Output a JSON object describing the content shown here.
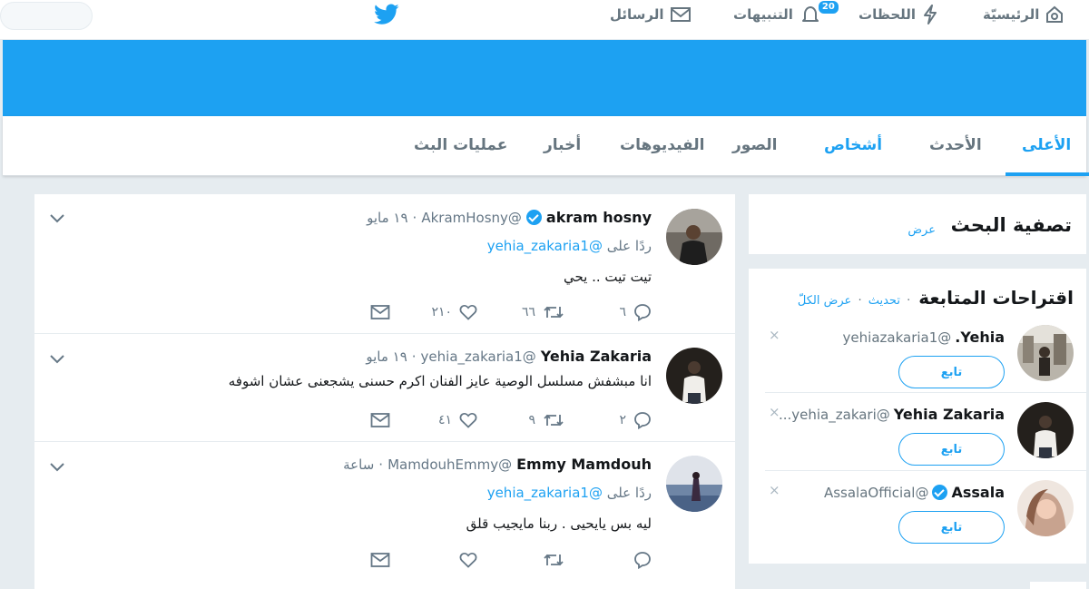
{
  "nav": {
    "home": "الرئيسيّة",
    "moments": "اللحظات",
    "notifications": "التنبيهات",
    "notifications_badge": "20",
    "messages": "الرسائل"
  },
  "tabs": {
    "top": "الأعلى",
    "latest": "الأحدث",
    "people": "أشخاص",
    "photos": "الصور",
    "videos": "الفيديوهات",
    "news": "أخبار",
    "broadcasts": "عمليات البث"
  },
  "filter": {
    "title": "تصفية البحث",
    "show": "عرض"
  },
  "wtf": {
    "title": "اقتراحات المتابعة",
    "refresh": "تحديث",
    "view_all": "عرض الكلّ",
    "sep": "·",
    "close": "×",
    "follow_label": "تابع",
    "items": [
      {
        "name": "Yehia.",
        "handle": "@yehiazakaria1"
      },
      {
        "name": "Yehia Zakaria",
        "handle": "@yehia_zakari..."
      },
      {
        "name": "Assala",
        "handle": "@AssalaOfficial"
      }
    ]
  },
  "tweets": [
    {
      "name": "akram hosny",
      "handle": "@AkramHosny",
      "time": "١٩ مايو",
      "reply_prefix": "ردًا على",
      "reply_to": "@yehia_zakaria1",
      "text": "تيت تيت .. يحي",
      "replies": "٦",
      "retweets": "٦٦",
      "likes": "٢١٠"
    },
    {
      "name": "Yehia Zakaria",
      "handle": "@yehia_zakaria1",
      "time": "١٩ مايو",
      "text": "انا مبشفش مسلسل الوصية عايز الفنان اكرم حسنى يشجعنى عشان اشوفه",
      "replies": "٢",
      "retweets": "٩",
      "likes": "٤١"
    },
    {
      "name": "Emmy Mamdouh",
      "handle": "@MamdouhEmmy",
      "time": "ساعة",
      "reply_prefix": "ردًا على",
      "reply_to": "@yehia_zakaria1",
      "text": "ليه بس يايحيى . ربنا مايجيب قلق",
      "replies": "",
      "retweets": "",
      "likes": ""
    }
  ],
  "colors": {
    "accent": "#1da1f2",
    "background": "#e6ecf0",
    "text_secondary": "#657786"
  }
}
